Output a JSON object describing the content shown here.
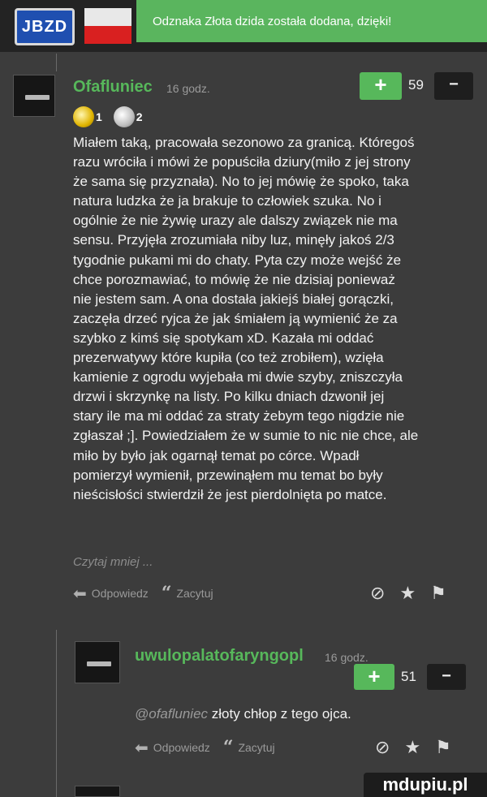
{
  "header": {
    "logo_text": "JBZD",
    "toast": "Odznaka Złota dzida została dodana, dzięki!"
  },
  "comment1": {
    "username": "Ofafluniec",
    "time": "16 godz.",
    "vote_plus": "+",
    "votes": "59",
    "vote_minus": "−",
    "badges": [
      {
        "icon": "gold-spear-badge-icon",
        "count": "1"
      },
      {
        "icon": "silver-spear-badge-icon",
        "count": "2"
      }
    ],
    "lines": [
      "Miałem taką, pracowała sezonowo za granicą. Któregoś",
      "razu wróciła i mówi że popuściła dziury(miło z jej strony",
      "że sama się przyznała). No to jej mówię że spoko, taka",
      "natura ludzka że ja brakuje to człowiek szuka. No i",
      "ogólnie że nie żywię urazy ale dalszy związek nie ma",
      "sensu. Przyjęła zrozumiała niby luz, minęły jakoś 2/3",
      "tygodnie pukami mi do chaty. Pyta czy może wejść że",
      "chce porozmawiać, to mówię że nie dzisiaj ponieważ",
      "nie jestem sam. A ona dostała jakiejś białej gorączki,",
      "zaczęła drzeć ryjca że jak śmiałem ją wymienić że za",
      "szybko z kimś się spotykam xD. Kazała mi oddać",
      "prezerwatywy które kupiła (co też zrobiłem), wzięła",
      "kamienie z ogrodu wyjebała mi dwie szyby, zniszczyła",
      "drzwi i skrzynkę na listy. Po kilku dniach dzwonił jej",
      "stary ile ma mi oddać za straty żebym tego nigdzie nie",
      "zgłaszał ;]. Powiedziałem że w sumie to nic nie chce, ale",
      "miło by było jak ogarnął temat po córce. Wpadł",
      "pomierzył wymienił, przewinąłem mu temat bo były",
      "nieścisłości stwierdził że jest pierdolnięta po matce."
    ],
    "read_more": "Czytaj mniej ...",
    "reply_label": "Odpowiedz",
    "quote_label": "Zacytuj"
  },
  "comment2": {
    "username": "uwulopalatofaryngopl",
    "time": "16 godz.",
    "vote_plus": "+",
    "votes": "51",
    "vote_minus": "−",
    "mention": "@ofafluniec",
    "text": "złoty chłop z tego ojca.",
    "reply_label": "Odpowiedz",
    "quote_label": "Zacytuj"
  },
  "watermark": "mdupiu.pl",
  "colors": {
    "background": "#3c3c3c",
    "username": "#57b85b",
    "toast": "#5ab55e"
  }
}
